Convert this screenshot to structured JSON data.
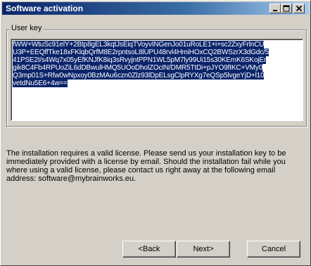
{
  "window": {
    "title": "Software activation",
    "controls": {
      "minimize_icon": "minimize-icon",
      "maximize_icon": "maximize-icon",
      "close_icon": "close-icon"
    }
  },
  "key_group": {
    "label": "User key",
    "lines": [
      "fWW+WtuSc91elY+2Btp8gEL3kqtJsEiqTVoyvINGenJo01uRoLE1+i+sc2ZxyFrlnCU",
      "U3P+EEQffTke18xFKlqbQrfM8E2rpntsoL8lUPU48rvl4HmiHOxCQ2BWSzrX3dGdc/5",
      "41PSE2I/s4Wq7x05yEfKNJfK8iq3sRvyjntPPN1WL5pM7ly99Ui15s30KEmK6SKojEr",
      "gik8C4Fb4RPUoZiL6dDBwulHMQ5UOoDholZOcIN/DMR5TtDi+pJYO9fIKC+VMy0",
      "Q3mp01S+Rfw0wNpxoy0BzMAu6czn0Zlz93lDpELsgClpRYXg7eQSp5lvgeYjD+l10",
      "vetdNu5E6+4w=="
    ]
  },
  "description": {
    "lines": [
      "The installation requires a valid license. Please send us your installation key to be",
      "immediately provided with a license by email. Should the installation fail while you",
      "where using a valid license, please contact us right away at the following email",
      "address: software@mybrainworks.eu."
    ]
  },
  "buttons": {
    "back": "<Back",
    "next": "Next>",
    "cancel": "Cancel"
  }
}
